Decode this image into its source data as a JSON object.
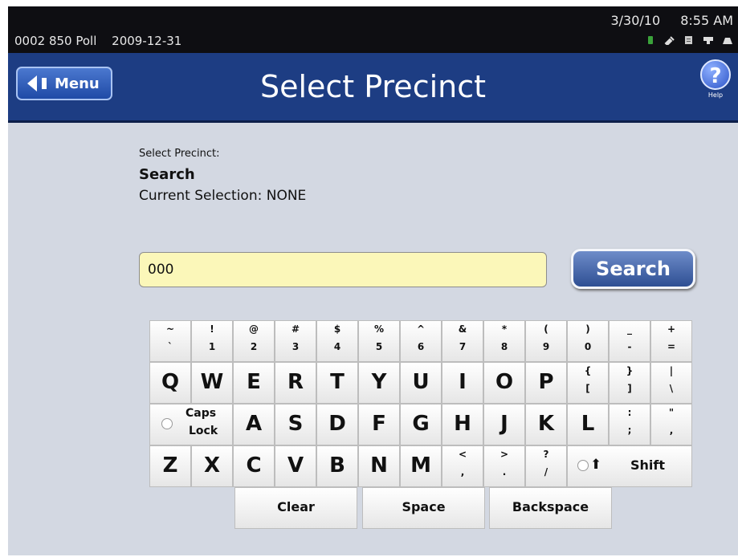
{
  "status_bar": {
    "machine_id": "0002 850 Poll",
    "date": "2009-12-31",
    "clock_date": "3/30/10",
    "clock_time": "8:55 AM",
    "icons": [
      "battery-icon",
      "plug-icon",
      "document-icon",
      "network-icon",
      "printer-icon"
    ]
  },
  "header": {
    "menu_label": "Menu",
    "title": "Select Precinct",
    "help_label": "Help"
  },
  "info": {
    "caption": "Select Precinct:",
    "heading": "Search",
    "current_selection": "Current Selection: NONE"
  },
  "search": {
    "value": "000",
    "button_label": "Search"
  },
  "keyboard": {
    "row1": [
      [
        "~",
        "`"
      ],
      [
        "!",
        "1"
      ],
      [
        "@",
        "2"
      ],
      [
        "#",
        "3"
      ],
      [
        "$",
        "4"
      ],
      [
        "%",
        "5"
      ],
      [
        "^",
        "6"
      ],
      [
        "&",
        "7"
      ],
      [
        "*",
        "8"
      ],
      [
        "(",
        "9"
      ],
      [
        ")",
        "0"
      ],
      [
        "_",
        "-"
      ],
      [
        "+",
        "="
      ]
    ],
    "row2": [
      "Q",
      "W",
      "E",
      "R",
      "T",
      "Y",
      "U",
      "I",
      "O",
      "P",
      [
        "{",
        "["
      ],
      [
        "}",
        "]"
      ],
      [
        "|",
        "\\"
      ]
    ],
    "caps": [
      "Caps",
      "Lock"
    ],
    "row3": [
      "A",
      "S",
      "D",
      "F",
      "G",
      "H",
      "J",
      "K",
      "L",
      [
        ":",
        ";"
      ],
      [
        "\"",
        ","
      ]
    ],
    "row4": [
      "Z",
      "X",
      "C",
      "V",
      "B",
      "N",
      "M",
      [
        "<",
        ","
      ],
      [
        ">",
        "."
      ],
      [
        "?",
        "/"
      ]
    ],
    "shift": "Shift",
    "clear": "Clear",
    "space": "Space",
    "backspace": "Backspace"
  },
  "colors": {
    "title_bar": "#1d3d83",
    "status_bar": "#0e0e12",
    "input_bg": "#fbf7b9",
    "battery": "#3aa23a"
  }
}
